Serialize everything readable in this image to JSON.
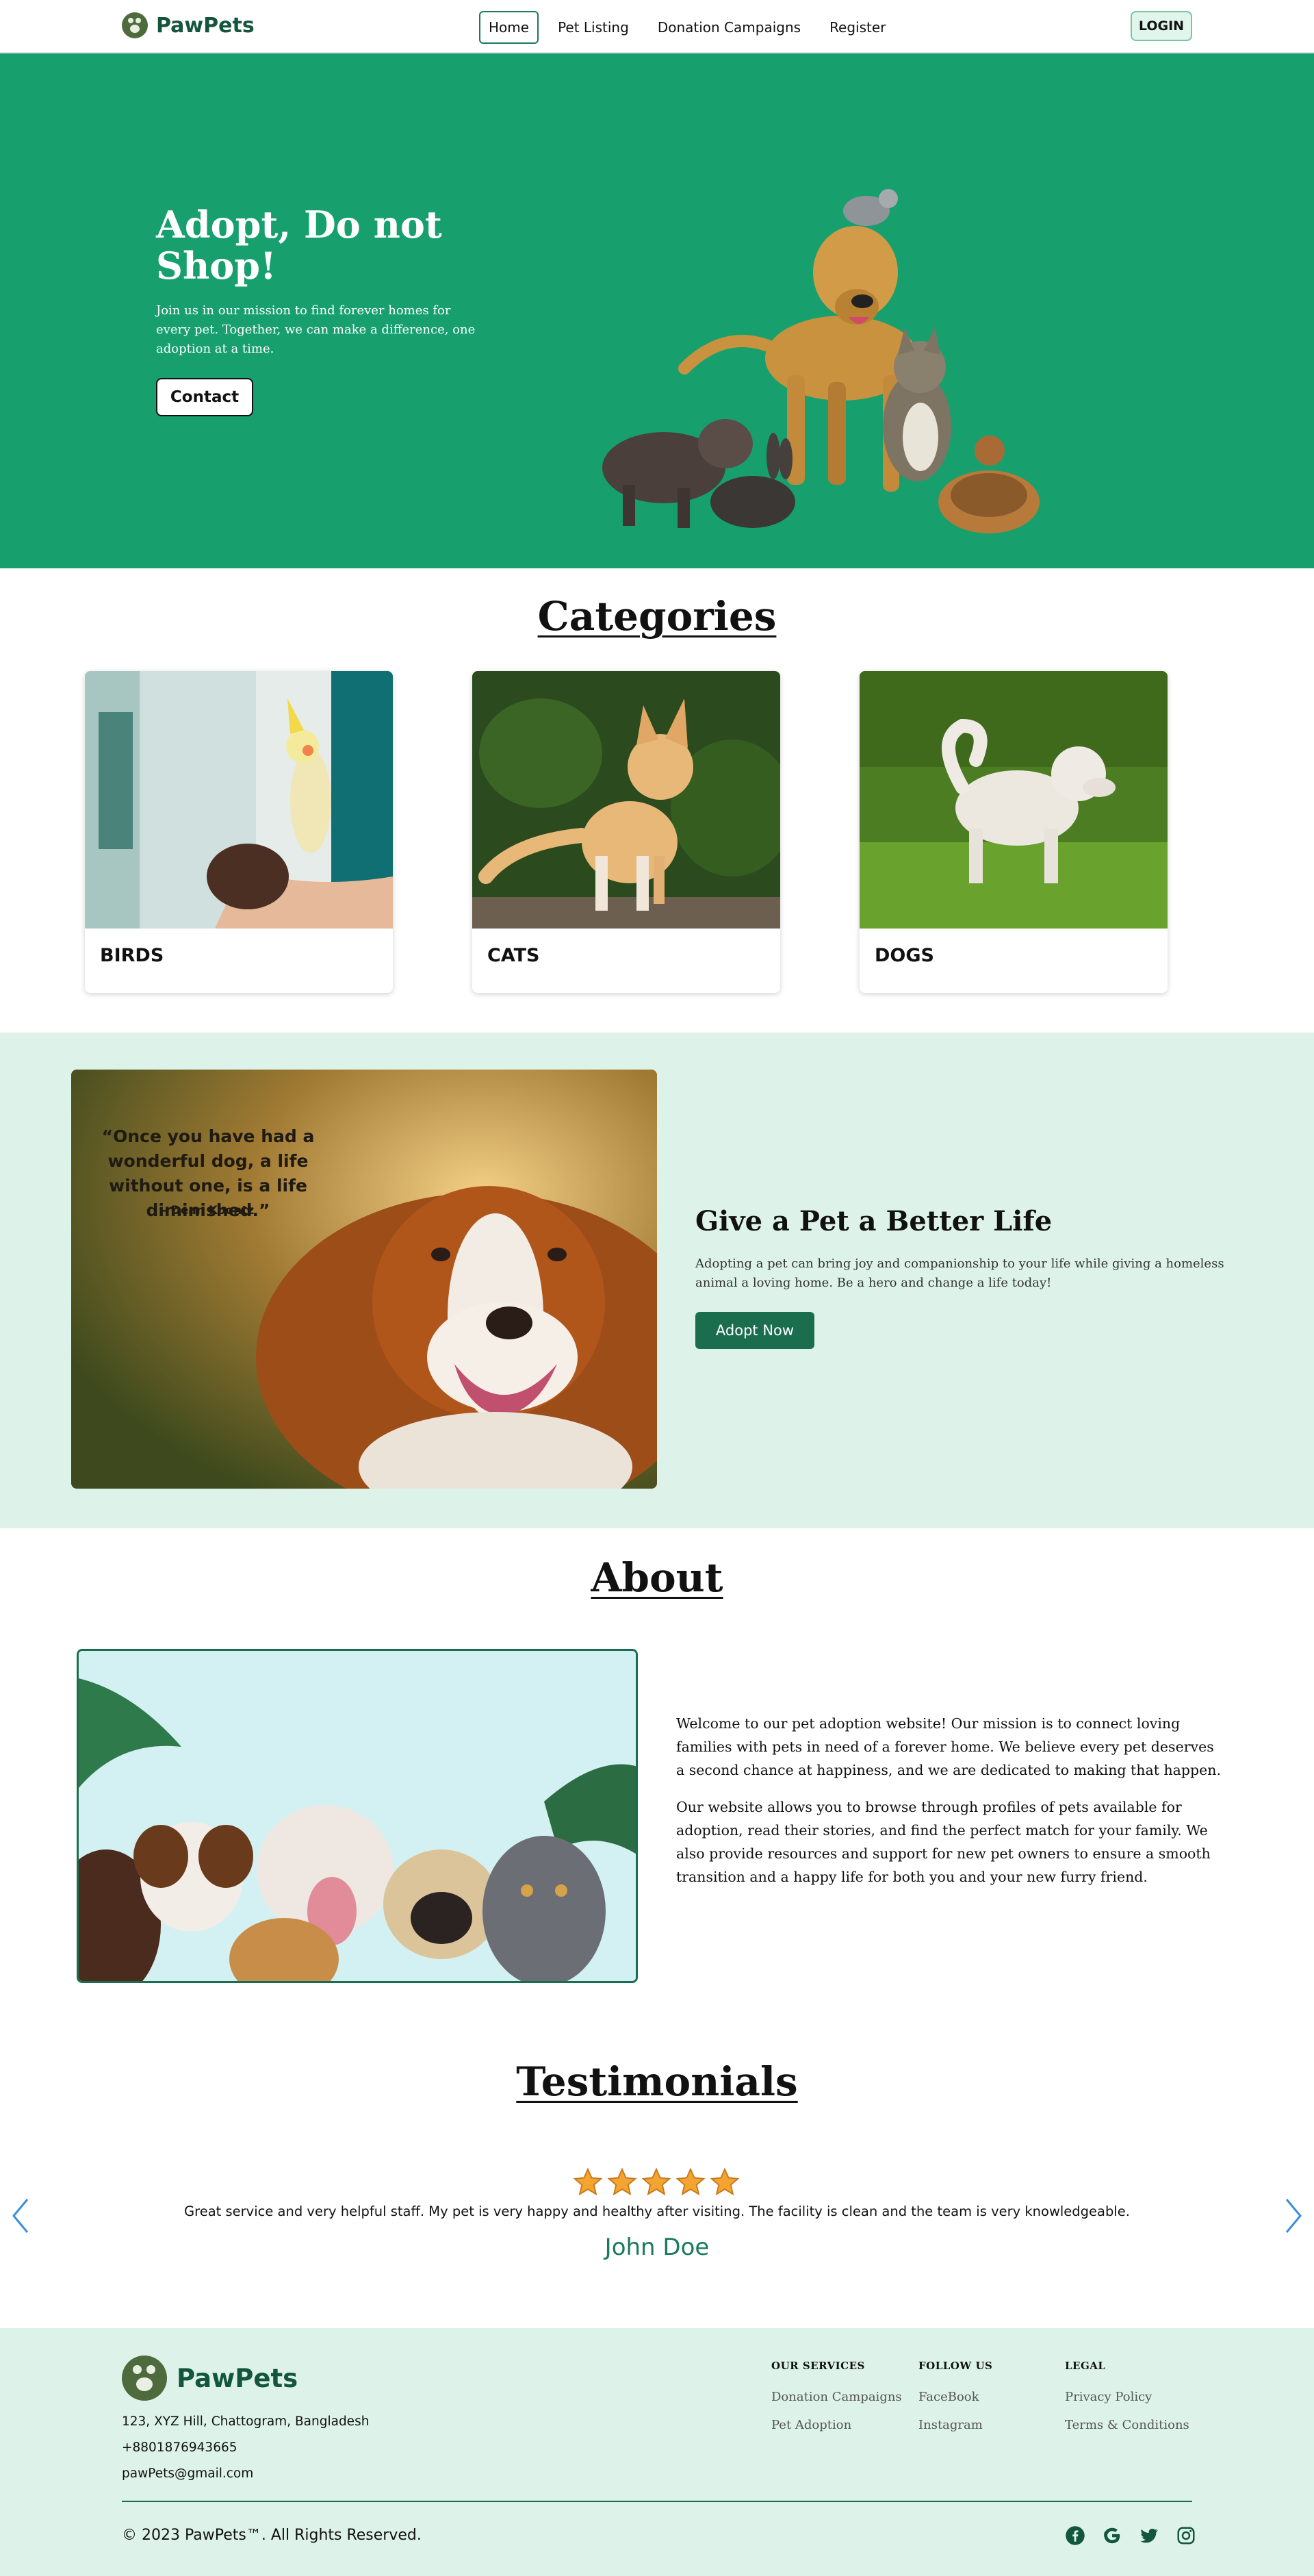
{
  "nav": {
    "brand": "PawPets",
    "links": [
      "Home",
      "Pet Listing",
      "Donation Campaigns",
      "Register"
    ],
    "active": "Home",
    "login": "LOGIN"
  },
  "hero": {
    "title": "Adopt, Do not Shop!",
    "text": "Join us in our mission to find forever homes for every pet. Together, we can make a difference, one adoption at a time.",
    "button": "Contact"
  },
  "categories": {
    "title": "Categories",
    "items": [
      {
        "label": "BIRDS"
      },
      {
        "label": "CATS"
      },
      {
        "label": "DOGS"
      }
    ]
  },
  "adopt": {
    "quote": "“Once you have had a wonderful dog, a life without one, is a life diminished.”",
    "quote_author": "- Dean Koontz",
    "title": "Give a Pet a Better Life",
    "text": "Adopting a pet can bring joy and companionship to your life while giving a homeless animal a loving home. Be a hero and change a life today!",
    "button": "Adopt Now"
  },
  "about": {
    "title": "About",
    "p1": "Welcome to our pet adoption website! Our mission is to connect loving families with pets in need of a forever home. We believe every pet deserves a second chance at happiness, and we are dedicated to making that happen.",
    "p2": "Our website allows you to browse through profiles of pets available for adoption, read their stories, and find the perfect match for your family. We also provide resources and support for new pet owners to ensure a smooth transition and a happy life for both you and your new furry friend."
  },
  "testimonials": {
    "title": "Testimonials",
    "rating": 5,
    "text": "Great service and very helpful staff. My pet is very happy and healthy after visiting. The facility is clean and the team is very knowledgeable.",
    "name": "John Doe"
  },
  "footer": {
    "brand": "PawPets",
    "address": "123, XYZ Hill, Chattogram, Bangladesh",
    "phone": "+8801876943665",
    "email": "pawPets@gmail.com",
    "services": {
      "title": "OUR SERVICES",
      "links": [
        "Donation Campaigns",
        "Pet Adoption"
      ]
    },
    "follow": {
      "title": "FOLLOW US",
      "links": [
        "FaceBook",
        "Instagram"
      ]
    },
    "legal": {
      "title": "LEGAL",
      "links": [
        "Privacy Policy",
        "Terms & Conditions"
      ]
    },
    "copyright": "© 2023 PawPets™. All Rights Reserved.",
    "social_icons": [
      "facebook-icon",
      "google-icon",
      "twitter-icon",
      "instagram-icon"
    ]
  },
  "colors": {
    "brand_green": "#17a06e",
    "dark_green": "#1b6e4d",
    "mint": "#ddf3e9"
  }
}
